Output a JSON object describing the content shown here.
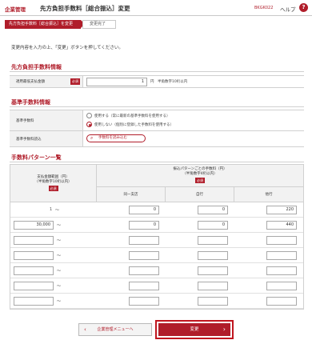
{
  "header": {
    "section": "企業管理",
    "title": "先方負担手数料［総合振込］変更",
    "screen_code": "BKGK022",
    "help_label": "ヘルプ",
    "help_icon": "?"
  },
  "steps": [
    "先方負担手数料［総合振込］を変更",
    "変更完了"
  ],
  "intro": "変更内容を入力の上、「変更」ボタンを押してください。",
  "section_sender_fee": {
    "title": "先方負担手数料情報",
    "row_label": "適用最低支払金額",
    "required": "必須",
    "value": "1",
    "unit_hint": "円　半角数字10桁以内"
  },
  "section_base_fee": {
    "title": "基準手数料情報",
    "base_fee_label": "基準手数料",
    "option_use": "使用する（常に最新の基準手数料を使用する）",
    "option_not_use": "使用しない（個別に登録した手数料を使用する）",
    "selected": "not_use",
    "load_label": "基準手数料読込",
    "load_button": "手数料を読み込む"
  },
  "fee_table": {
    "title": "手数料パターン一覧",
    "col_amount": "支払金額範囲（円）",
    "col_amount_hint": "（半角数字10桁以内）",
    "col_pattern": "振込パターンごとの手数料（円）",
    "col_pattern_hint": "（半角数字4桁以内）",
    "required": "必須",
    "col_same_branch": "同一支店",
    "col_same_bank": "自行",
    "col_other_bank": "他行",
    "tilde": "～",
    "rows": [
      {
        "from": "1",
        "same_branch": "0",
        "same_bank": "0",
        "other_bank": "220",
        "editable_from": false
      },
      {
        "from": "30,000",
        "same_branch": "0",
        "same_bank": "0",
        "other_bank": "440",
        "editable_from": true
      },
      {
        "from": "",
        "same_branch": "",
        "same_bank": "",
        "other_bank": "",
        "editable_from": true
      },
      {
        "from": "",
        "same_branch": "",
        "same_bank": "",
        "other_bank": "",
        "editable_from": true
      },
      {
        "from": "",
        "same_branch": "",
        "same_bank": "",
        "other_bank": "",
        "editable_from": true
      },
      {
        "from": "",
        "same_branch": "",
        "same_bank": "",
        "other_bank": "",
        "editable_from": true
      },
      {
        "from": "",
        "same_branch": "",
        "same_bank": "",
        "other_bank": "",
        "editable_from": true
      }
    ]
  },
  "footer": {
    "back_label": "企業管理メニューへ",
    "submit_label": "変更"
  },
  "colors": {
    "accent": "#b01d2a"
  }
}
